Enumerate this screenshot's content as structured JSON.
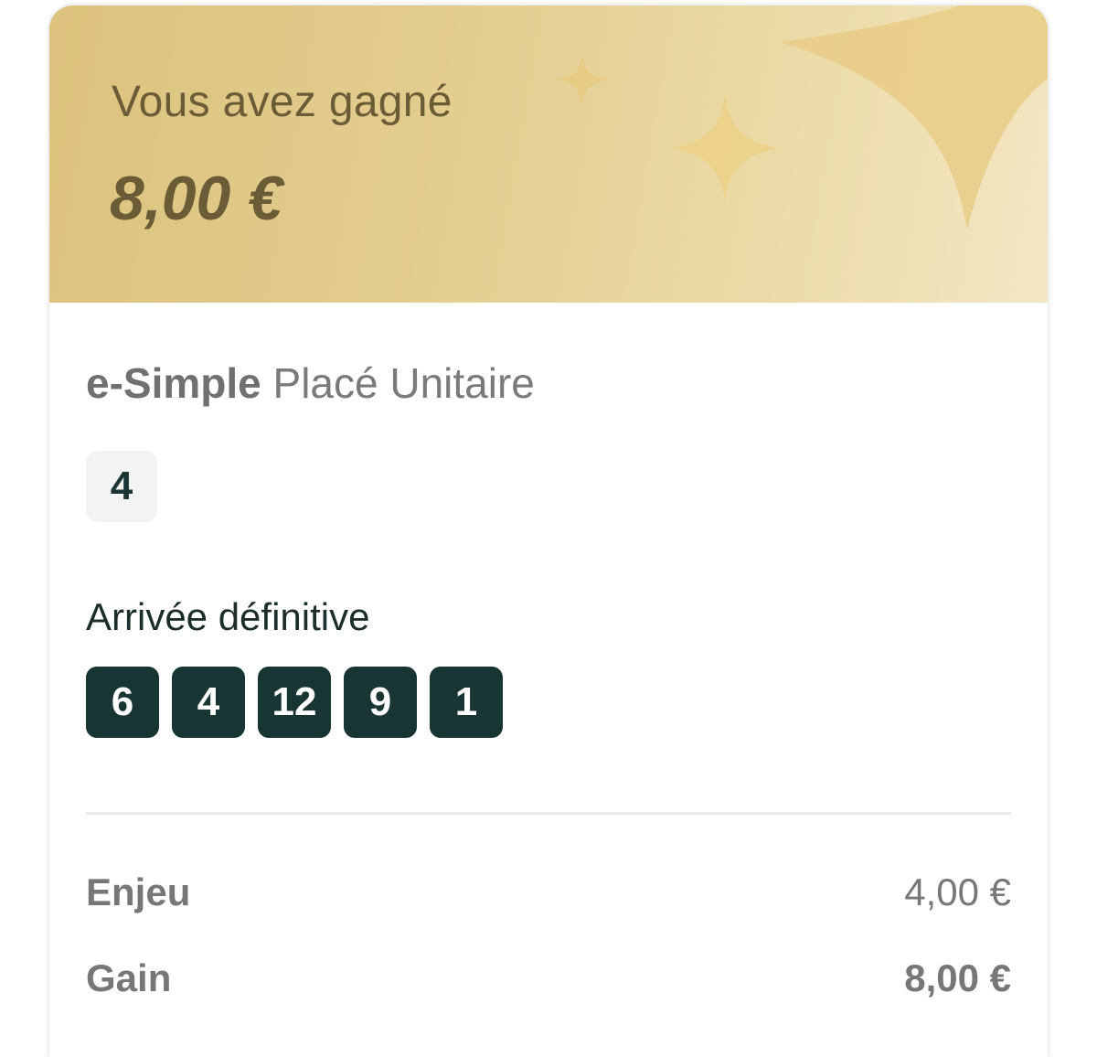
{
  "banner": {
    "label": "Vous avez gagné",
    "amount": "8,00 €",
    "colors": {
      "gradient_start": "#dcc27d",
      "gradient_end": "#f3e6c3",
      "text": "#6b5c38",
      "sparkle": "#e9c97a"
    },
    "decoration": "sparkle-icon"
  },
  "bet": {
    "type_label": "e-Simple",
    "kind_label": "Placé Unitaire",
    "selection": [
      "4"
    ]
  },
  "arrival": {
    "label": "Arrivée définitive",
    "numbers": [
      "6",
      "4",
      "12",
      "9",
      "1"
    ],
    "chip_color": "#183533"
  },
  "summary": {
    "stake_label": "Enjeu",
    "stake_value": "4,00 €",
    "gain_label": "Gain",
    "gain_value": "8,00 €"
  }
}
